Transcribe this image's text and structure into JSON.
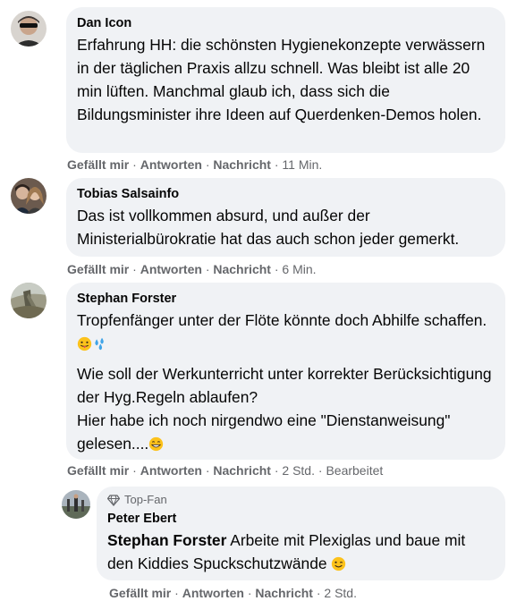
{
  "comments": [
    {
      "author": "Dan Icon",
      "paragraphs": [
        "Erfahrung HH: die schönsten Hygienekonzepte verwässern in der täglichen Praxis allzu schnell. Was bleibt ist alle 20 min lüften. Manchmal glaub ich, dass sich die Bildungsminister ihre Ideen auf Querdenken-Demos holen."
      ],
      "like": "Gefällt mir",
      "reply": "Antworten",
      "message": "Nachricht",
      "time": "11 Min."
    },
    {
      "author": "Tobias Salsainfo",
      "paragraphs": [
        "Das ist vollkommen absurd, und außer der Ministerialbürokratie hat das auch schon jeder gemerkt."
      ],
      "like": "Gefällt mir",
      "reply": "Antworten",
      "message": "Nachricht",
      "time": "6 Min."
    },
    {
      "author": "Stephan Forster",
      "paragraph1": "Tropfenfänger unter der Flöte könnte doch Abhilfe schaffen.",
      "paragraph2_line1": "Wie soll der Werkunterricht unter korrekter Berücksichtigung der Hyg.Regeln ablaufen?",
      "paragraph2_line2": "Hier habe ich noch nirgendwo eine \"Dienstanweisung\" gelesen....",
      "emojis": [
        "face-with-tongue",
        "sweat-droplets",
        "grinning-face"
      ],
      "like": "Gefällt mir",
      "reply": "Antworten",
      "message": "Nachricht",
      "time": "2 Std.",
      "edited": "Bearbeitet"
    },
    {
      "badge": "Top-Fan",
      "author": "Peter Ebert",
      "mention": "Stephan Forster",
      "text": " Arbeite mit Plexiglas und baue mit den Kiddies Spuckschutzwände",
      "emoji": "winking-face",
      "like": "Gefällt mir",
      "reply": "Antworten",
      "message": "Nachricht",
      "time": "2 Std."
    }
  ],
  "separator": "·",
  "colors": {
    "bubble": "#f0f2f5",
    "meta": "#65676b",
    "text": "#050505"
  }
}
